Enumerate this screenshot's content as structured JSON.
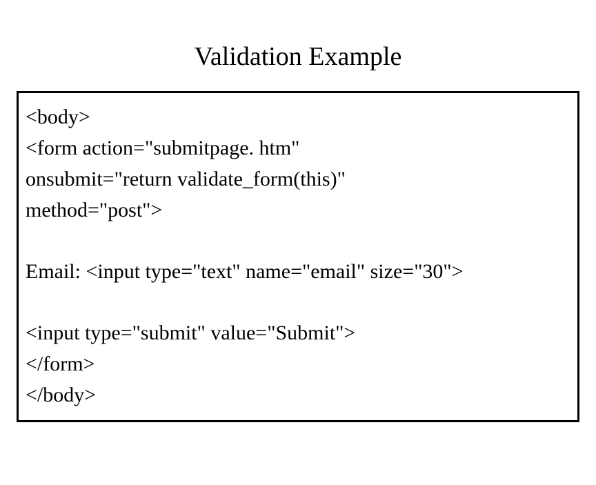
{
  "title": "Validation Example",
  "code": {
    "line1": "<body>",
    "line2": "<form action=\"submitpage. htm\"",
    "line3": "onsubmit=\"return validate_form(this)\"",
    "line4": "method=\"post\">",
    "line5": "Email: <input type=\"text\" name=\"email\" size=\"30\">",
    "line6": "<input type=\"submit\" value=\"Submit\">",
    "line7": "</form>",
    "line8": "</body>"
  }
}
